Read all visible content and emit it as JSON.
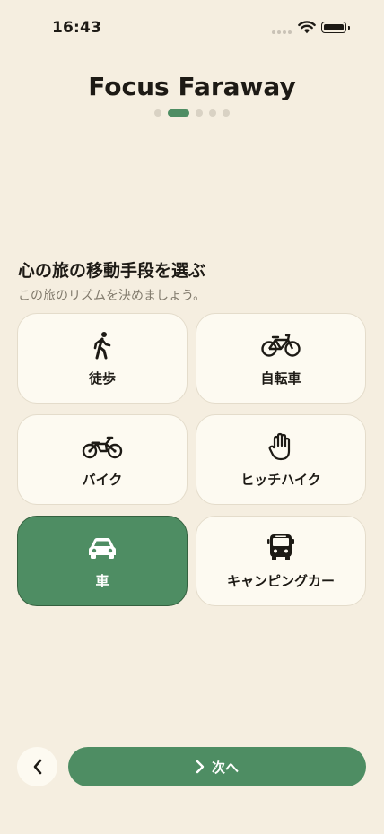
{
  "status_bar": {
    "time": "16:43"
  },
  "app": {
    "title": "Focus Faraway"
  },
  "progress": {
    "total_steps": 5,
    "current_step": 2
  },
  "prompt": {
    "title": "心の旅の移動手段を選ぶ",
    "subtitle": "この旅のリズムを決めましょう。"
  },
  "options": [
    {
      "label": "徒歩",
      "icon": "walking-person-icon",
      "selected": false
    },
    {
      "label": "自転車",
      "icon": "bicycle-icon",
      "selected": false
    },
    {
      "label": "バイク",
      "icon": "motorcycle-icon",
      "selected": false
    },
    {
      "label": "ヒッチハイク",
      "icon": "raised-hand-icon",
      "selected": false
    },
    {
      "label": "車",
      "icon": "car-icon",
      "selected": true
    },
    {
      "label": "キャンピングカー",
      "icon": "bus-icon",
      "selected": false
    }
  ],
  "nav": {
    "next_label": "次へ",
    "back_icon": "chevron-left-icon",
    "next_icon": "chevron-right-icon"
  },
  "colors": {
    "background": "#f5eee0",
    "accent": "#4e8d63",
    "card": "#fdfaf1",
    "text": "#1d1a15",
    "muted": "#817a6c"
  }
}
